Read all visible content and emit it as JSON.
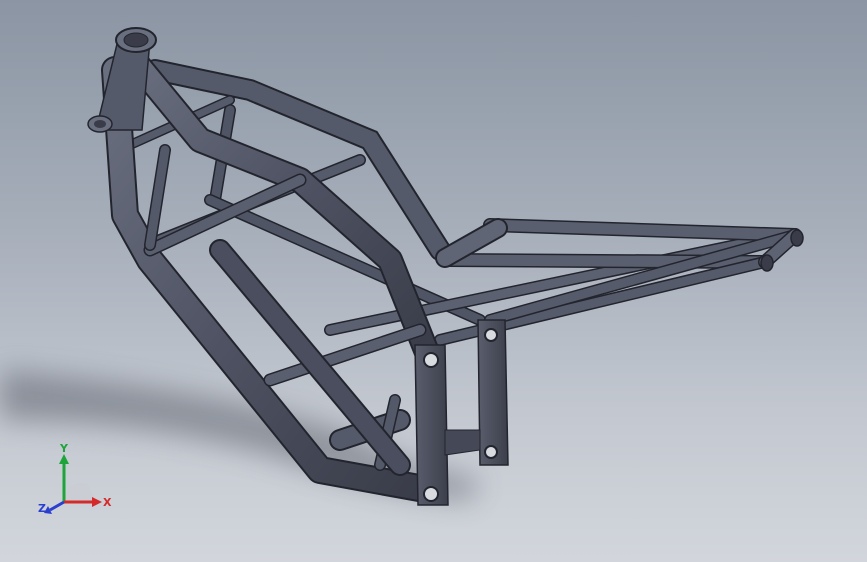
{
  "viewport": {
    "background_top": "#8b95a3",
    "background_bottom": "#d2d6dc",
    "model_color": "#4e5262",
    "model_edge": "#23252e"
  },
  "triad": {
    "x_label": "X",
    "y_label": "Y",
    "z_label": "Z",
    "x_color": "#d42a2a",
    "y_color": "#1ea43a",
    "z_color": "#2a3fd0"
  }
}
